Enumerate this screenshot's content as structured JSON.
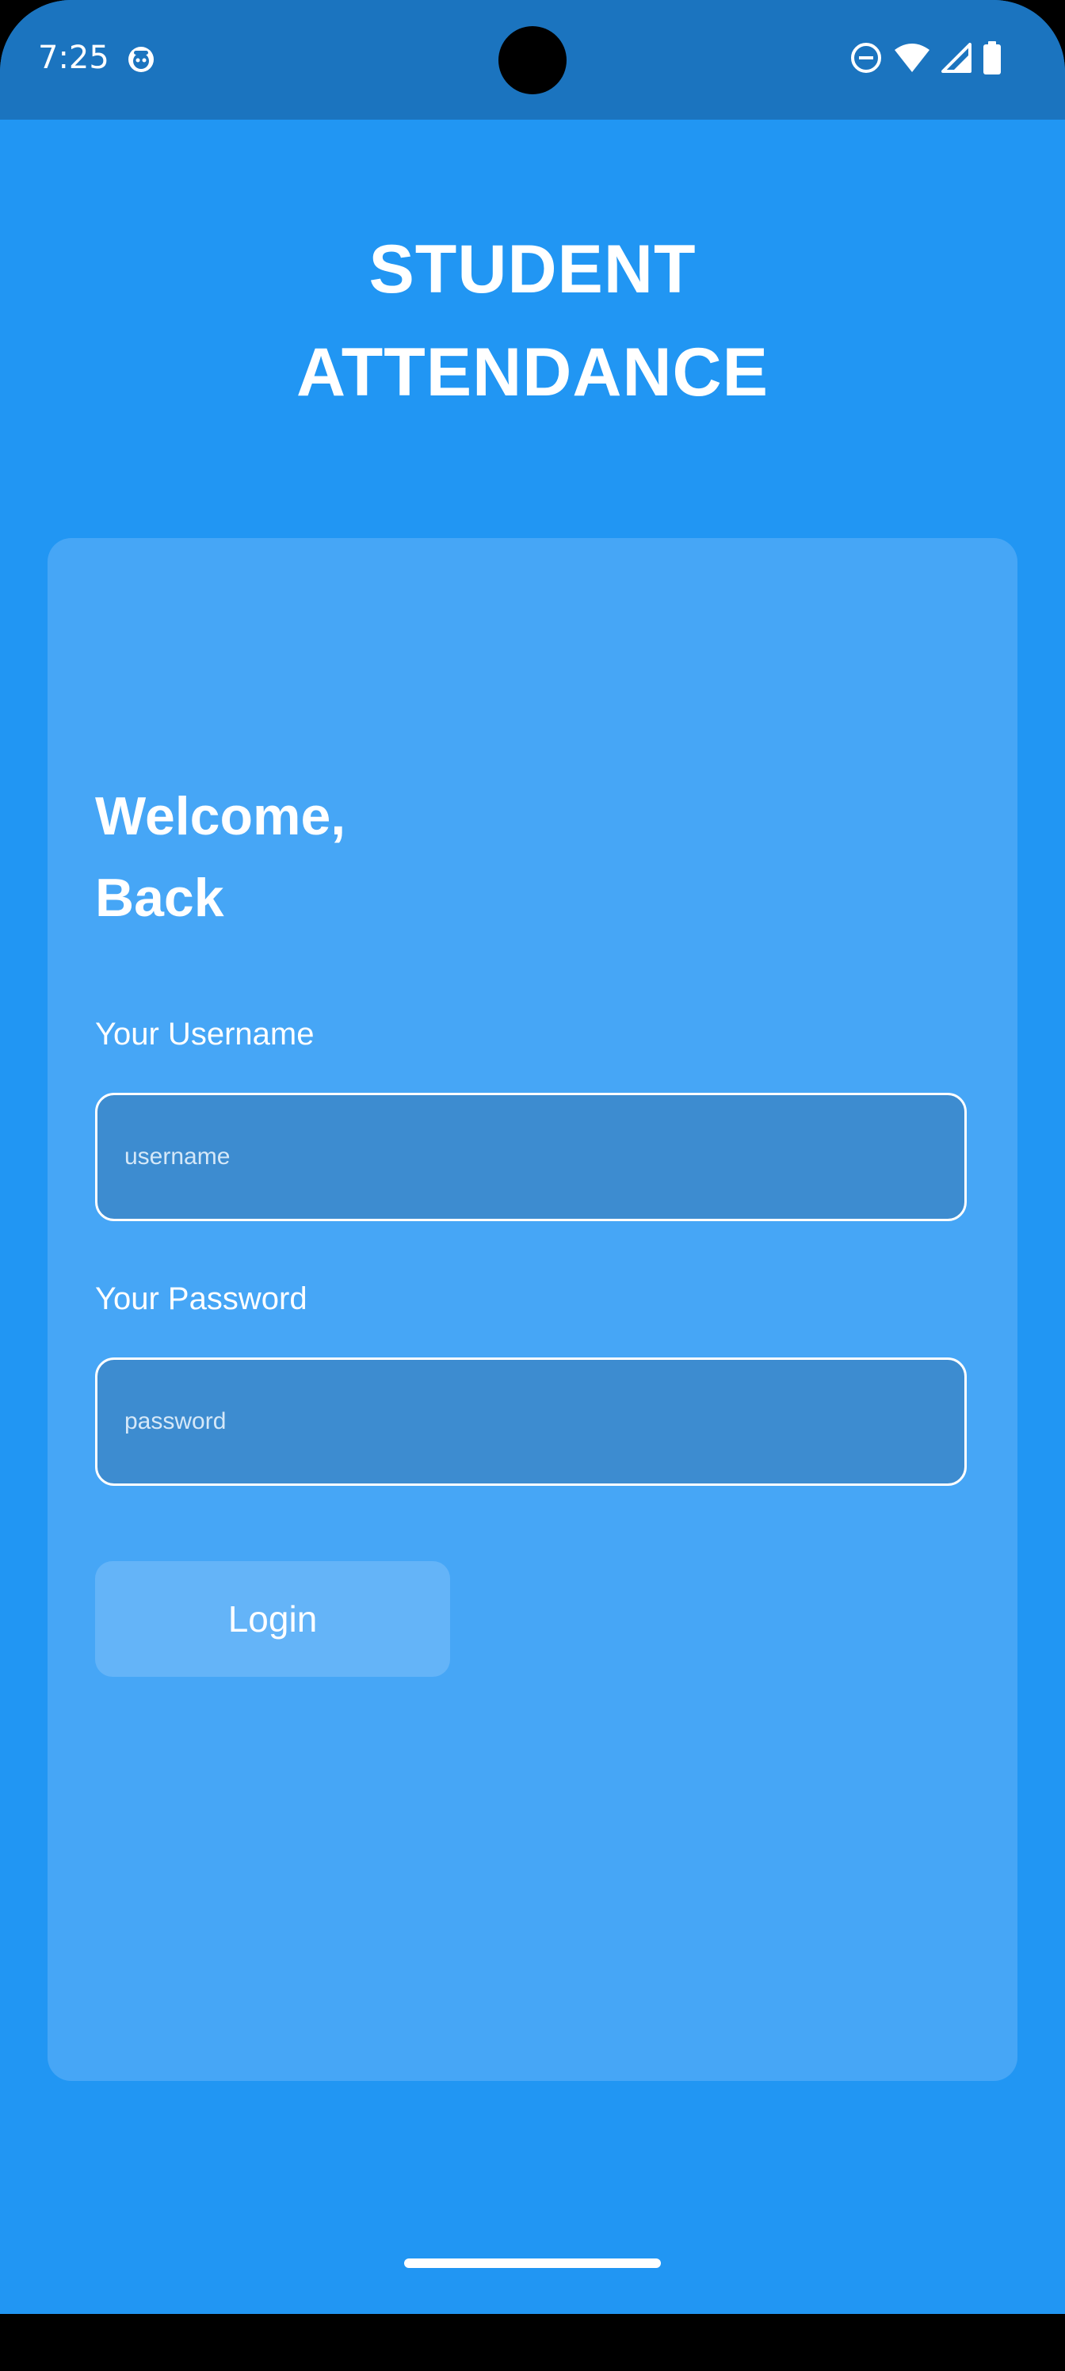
{
  "status_bar": {
    "time": "7:25",
    "icons": [
      "app-notification-icon",
      "do-not-disturb-icon",
      "wifi-icon",
      "cellular-signal-icon",
      "battery-icon"
    ]
  },
  "app": {
    "title_line1": "STUDENT",
    "title_line2": "ATTENDANCE"
  },
  "login_card": {
    "welcome_line1": "Welcome,",
    "welcome_line2": "Back",
    "username_label": "Your Username",
    "username_placeholder": "username",
    "username_value": "",
    "password_label": "Your Password",
    "password_placeholder": "password",
    "password_value": "",
    "login_button": "Login"
  },
  "colors": {
    "background": "#2196F3",
    "status_bar": "#1B74BF",
    "card": "#46A6F6",
    "input_fill": "#3D8CD0",
    "button_fill": "#64B4F8",
    "text": "#FFFFFF"
  }
}
